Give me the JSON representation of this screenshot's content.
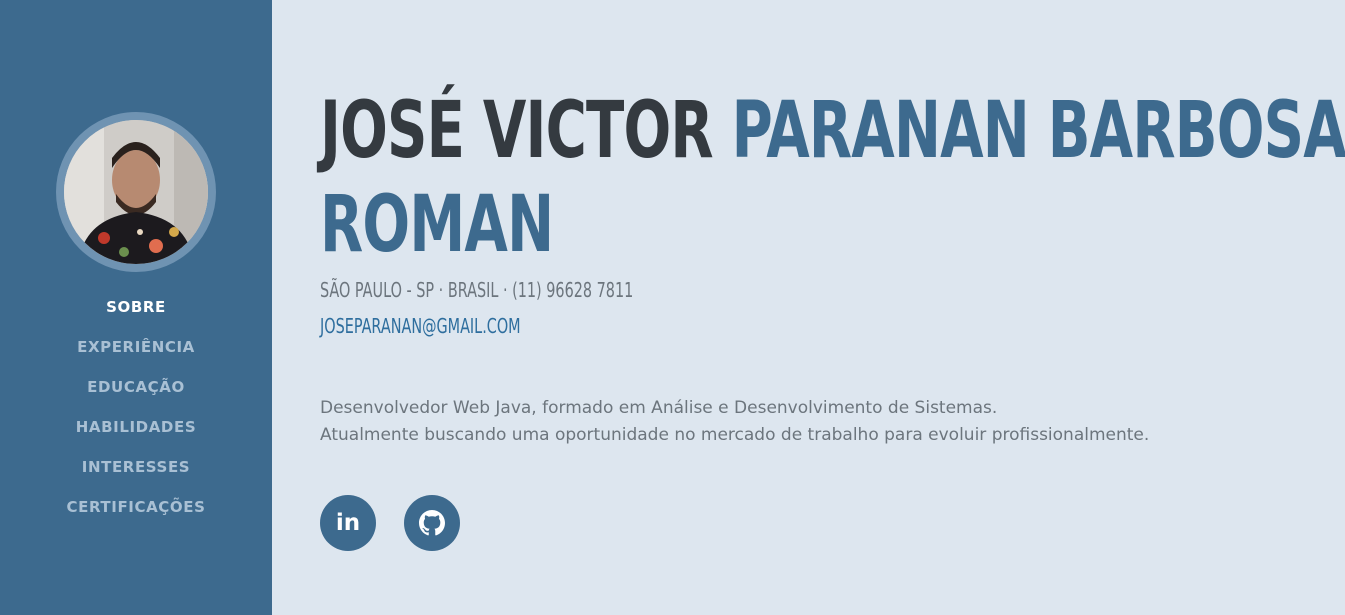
{
  "profile": {
    "first_name": "JOSÉ VICTOR",
    "last_name_line1": "PARANAN BARBOSA",
    "last_name_line2": "ROMAN",
    "contact_line": "SÃO PAULO - SP · BRASIL · (11) 96628 7811",
    "email": "JOSEPARANAN@GMAIL.COM",
    "summary_line1": "Desenvolvedor Web Java, formado em Análise e Desenvolvimento de Sistemas.",
    "summary_line2": "Atualmente buscando uma oportunidade no mercado de trabalho para evoluir profissionalmente."
  },
  "sidebar": {
    "items": [
      {
        "label": "SOBRE",
        "active": true
      },
      {
        "label": "EXPERIÊNCIA",
        "active": false
      },
      {
        "label": "EDUCAÇÃO",
        "active": false
      },
      {
        "label": "HABILIDADES",
        "active": false
      },
      {
        "label": "INTERESSES",
        "active": false
      },
      {
        "label": "CERTIFICAÇÕES",
        "active": false
      }
    ]
  },
  "socials": {
    "linkedin_text": "in",
    "linkedin_icon": "linkedin-icon",
    "github_icon": "github-icon"
  },
  "colors": {
    "sidebar_bg": "#3d6a8e",
    "page_bg": "#dde6ef",
    "accent": "#3d6a8e",
    "name_dark": "#343a40",
    "muted_text": "#6c757d",
    "link": "#2e6e9e"
  }
}
